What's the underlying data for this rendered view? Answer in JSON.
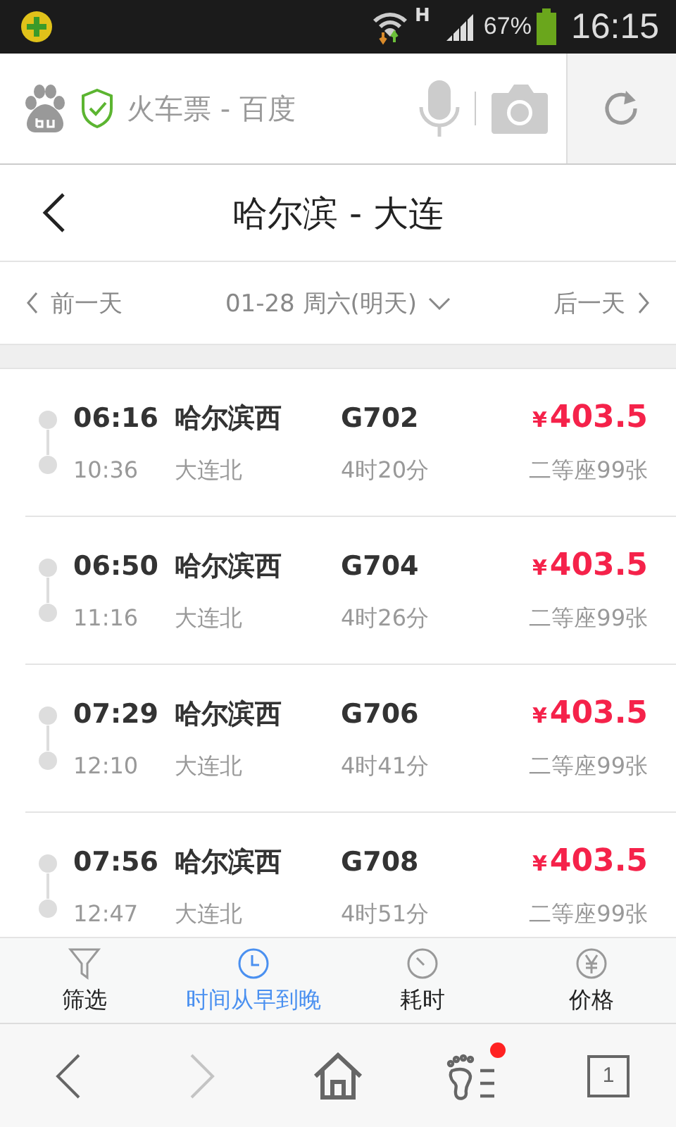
{
  "status_bar": {
    "network": "H",
    "battery": "67%",
    "time": "16:15"
  },
  "address_bar": {
    "title": "火车票 - 百度"
  },
  "header": {
    "title": "哈尔滨 - 大连"
  },
  "date_nav": {
    "prev": "前一天",
    "date": "01-28 周六(明天)",
    "next": "后一天"
  },
  "trains": [
    {
      "depart_time": "06:16",
      "arrive_time": "10:36",
      "from": "哈尔滨西",
      "to": "大连北",
      "number": "G702",
      "duration": "4时20分",
      "currency": "¥",
      "price": "403.5",
      "seats": "二等座99张"
    },
    {
      "depart_time": "06:50",
      "arrive_time": "11:16",
      "from": "哈尔滨西",
      "to": "大连北",
      "number": "G704",
      "duration": "4时26分",
      "currency": "¥",
      "price": "403.5",
      "seats": "二等座99张"
    },
    {
      "depart_time": "07:29",
      "arrive_time": "12:10",
      "from": "哈尔滨西",
      "to": "大连北",
      "number": "G706",
      "duration": "4时41分",
      "currency": "¥",
      "price": "403.5",
      "seats": "二等座99张"
    },
    {
      "depart_time": "07:56",
      "arrive_time": "12:47",
      "from": "哈尔滨西",
      "to": "大连北",
      "number": "G708",
      "duration": "4时51分",
      "currency": "¥",
      "price": "403.5",
      "seats": "二等座99张"
    }
  ],
  "sort_bar": [
    {
      "kind": "filter",
      "label": "筛选",
      "selected": false
    },
    {
      "kind": "clock",
      "label": "时间从早到晚",
      "selected": true
    },
    {
      "kind": "timer",
      "label": "耗时",
      "selected": false
    },
    {
      "kind": "yen",
      "label": "价格",
      "selected": false
    }
  ],
  "bottom_nav": [
    {
      "kind": "back",
      "disabled": false,
      "badge": false
    },
    {
      "kind": "forward",
      "disabled": true,
      "badge": false
    },
    {
      "kind": "home",
      "disabled": false,
      "badge": false
    },
    {
      "kind": "footprints",
      "disabled": false,
      "badge": true
    },
    {
      "kind": "tabs",
      "disabled": false,
      "badge": false,
      "count": "1"
    }
  ]
}
